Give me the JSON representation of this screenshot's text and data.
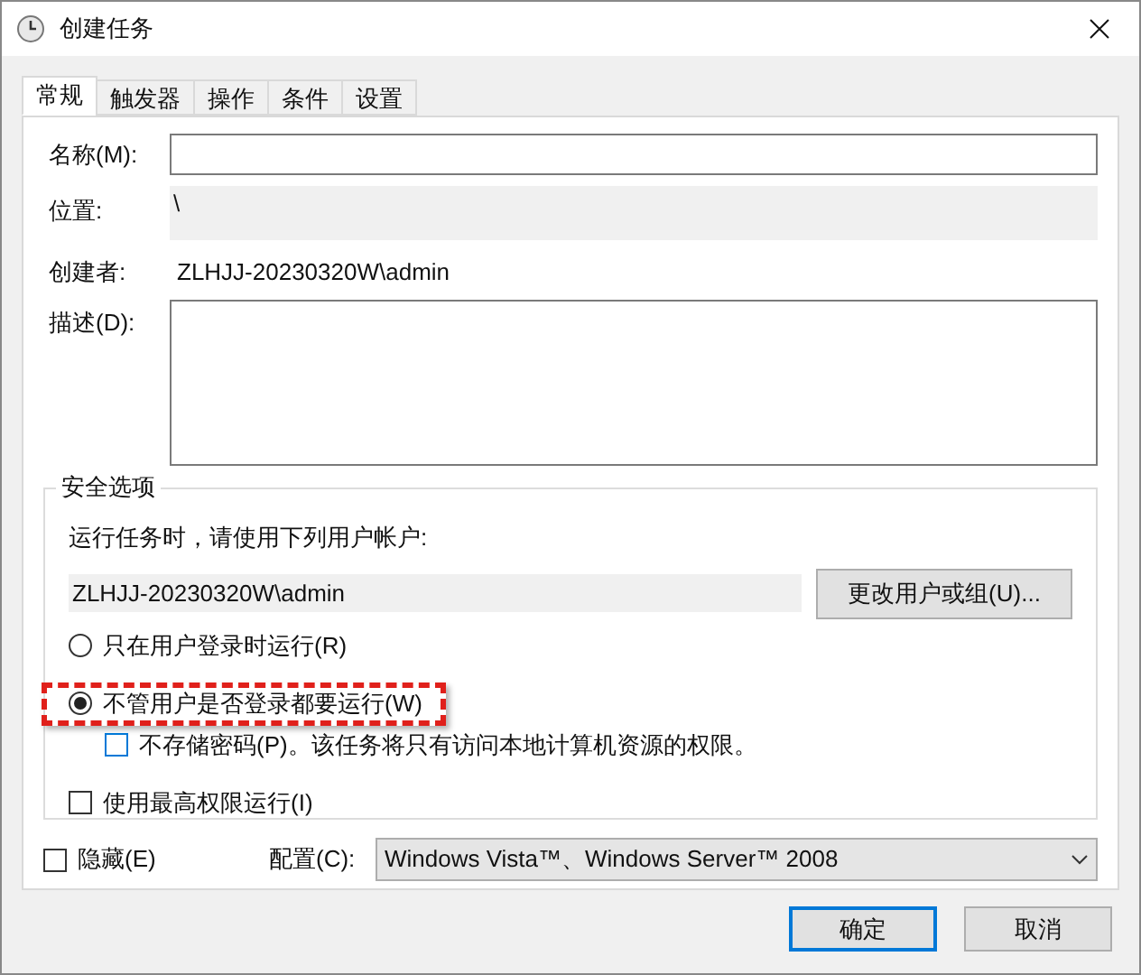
{
  "window": {
    "title": "创建任务"
  },
  "tabs": [
    {
      "label": "常规",
      "selected": true
    },
    {
      "label": "触发器",
      "selected": false
    },
    {
      "label": "操作",
      "selected": false
    },
    {
      "label": "条件",
      "selected": false
    },
    {
      "label": "设置",
      "selected": false
    }
  ],
  "name_field": {
    "label": "名称(M):"
  },
  "location": {
    "label": "位置:",
    "value": "\\"
  },
  "author": {
    "label": "创建者:",
    "value": "ZLHJJ-20230320W\\admin"
  },
  "description": {
    "label": "描述(D):"
  },
  "security": {
    "title": "安全选项",
    "prompt": "运行任务时，请使用下列用户帐户:",
    "account": "ZLHJJ-20230320W\\admin",
    "change_button": "更改用户或组(U)...",
    "run_options": [
      {
        "label": "只在用户登录时运行(R)",
        "selected": false,
        "highlighted": false
      },
      {
        "label": "不管用户是否登录都要运行(W)",
        "selected": true,
        "highlighted": true
      }
    ],
    "no_store_password": {
      "label": "不存储密码(P)。该任务将只有访问本地计算机资源的权限。",
      "checked": false
    },
    "highest_privileges": {
      "label": "使用最高权限运行(I)",
      "checked": false
    }
  },
  "hidden": {
    "label": "隐藏(E)",
    "checked": false
  },
  "configure": {
    "label": "配置(C):",
    "value": "Windows Vista™、Windows Server™ 2008"
  },
  "buttons": [
    {
      "label": "确定",
      "default": true
    },
    {
      "label": "取消",
      "default": false
    }
  ]
}
